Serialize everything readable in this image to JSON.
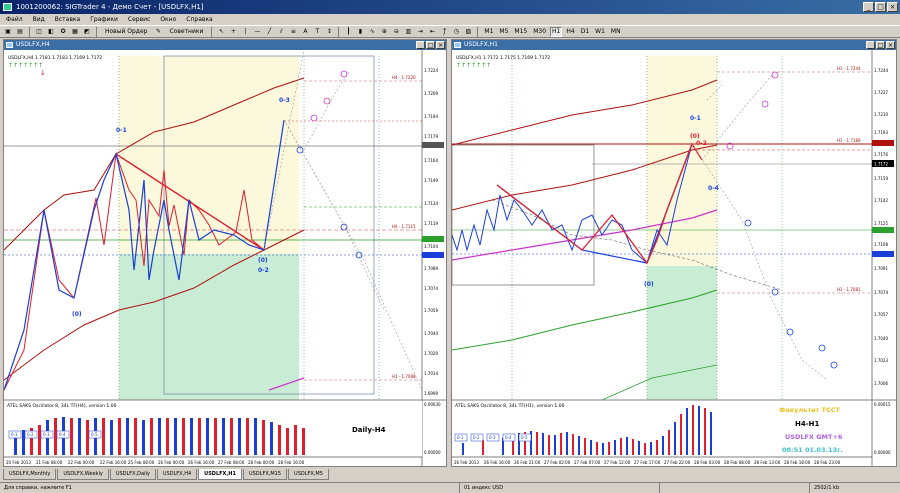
{
  "window": {
    "title": "1001200062: SIGTrader 4 - Демо Счет - [USDLFX,H1]",
    "min": "_",
    "max": "□",
    "close": "×"
  },
  "menu": [
    "Файл",
    "Вид",
    "Вставка",
    "Графики",
    "Сервис",
    "Окно",
    "Справка"
  ],
  "toolbar": {
    "new_order": "Новый Ордер",
    "experts": "Советники",
    "timeframes": [
      "M1",
      "M5",
      "M15",
      "M30",
      "H1",
      "H4",
      "D1",
      "W1",
      "MN"
    ],
    "active_tf": "H1"
  },
  "left_chart": {
    "window_title": "USDLFX,H4",
    "info_line": "USDLFX,H4  1.7181 1.7183 1.7169 1.7172",
    "prices": [
      "1.7224",
      "1.7209",
      "1.7194",
      "1.7179",
      "1.7164",
      "1.7149",
      "1.7134",
      "1.7119",
      "1.7104",
      "1.7089",
      "1.7074",
      "1.7059",
      "1.7044",
      "1.7029",
      "1.7014",
      "1.6999"
    ],
    "hl_labels": [
      "H4 - 1.7220",
      "H4 - 1.7115",
      "H1 - 1.7088"
    ],
    "wave_labels": [
      "0-1",
      "0-3",
      "(0)",
      "(0)",
      "0-2"
    ],
    "osc_title": "ATEL SAKS Oscillator 8, 34L TF(H4), version 1.00",
    "osc_scale": [
      "0.00030",
      "0.00000"
    ],
    "blocks": [
      "0-1",
      "0-2",
      "0-3",
      "0-4",
      "0-5"
    ],
    "time_labels": [
      "20 Feb 2013",
      "21 Feb 08:00",
      "22 Feb 00:00",
      "22 Feb 16:00",
      "25 Feb 08:00",
      "26 Feb 00:00",
      "26 Feb 16:00",
      "27 Feb 08:00",
      "28 Feb 00:00",
      "28 Feb 16:00"
    ],
    "period_label": "Daily-H4"
  },
  "right_chart": {
    "window_title": "USDLFX,H1",
    "info_line": "USDLFX,H1  1.7172 1.7175 1.7169 1.7172",
    "prices": [
      "1.7244",
      "1.7227",
      "1.7210",
      "1.7193",
      "1.7176",
      "1.7159",
      "1.7142",
      "1.7125",
      "1.7108",
      "1.7091",
      "1.7074",
      "1.7057",
      "1.7040",
      "1.7023",
      "1.7006"
    ],
    "hl_labels": [
      "H1 - 1.7244",
      "H1 - 1.7189",
      "H1 - 1.7081"
    ],
    "wave_labels": [
      "0-1",
      "(0)",
      "0-2",
      "0-4",
      "(0)"
    ],
    "osc_title": "ATEL SAKS Oscillator 8, 34L TF(H1), version 1.00",
    "osc_scale": [
      "0.00015",
      "0.00000"
    ],
    "blocks": [
      "0-1",
      "0-2",
      "0-3",
      "0-4",
      "0-5"
    ],
    "time_labels": [
      "26 Feb 2013",
      "26 Feb 16:00",
      "26 Feb 21:00",
      "27 Feb 02:00",
      "27 Feb 07:00",
      "27 Feb 12:00",
      "27 Feb 17:00",
      "27 Feb 22:00",
      "28 Feb 03:00",
      "28 Feb 08:00",
      "28 Feb 13:00",
      "28 Feb 18:00",
      "28 Feb 23:00"
    ],
    "overlay": {
      "line1": "Факультет ТССТ",
      "line2": "H4-H1",
      "line3": "USDLFX GMT+6",
      "line4": "08:51 01.03.13г."
    },
    "current_price": "1.7172"
  },
  "tabs": [
    "USDLFX,Monthly",
    "USDLFX,Weekly",
    "USDLFX,Daily",
    "USDLFX,H4",
    "USDLFX,H1",
    "USDLFX,M15",
    "USDLFX,M5"
  ],
  "active_tab": "USDLFX,H1",
  "status": {
    "help": "Для справки, нажмите F1",
    "profile": "01 индекс USD",
    "traffic": "2502/1 kb"
  },
  "colors": {
    "wave_blue": "#1a3fd6",
    "wave_red": "#e01f2e",
    "channel_red": "#b01010",
    "magenta": "#cc33cc",
    "green": "#2ca02c",
    "cream": "#fbf8dc",
    "mint": "#c9ecd4",
    "overlay_yellow": "#e8c020",
    "overlay_purple": "#b060e0",
    "overlay_cyan": "#40c0d0"
  }
}
